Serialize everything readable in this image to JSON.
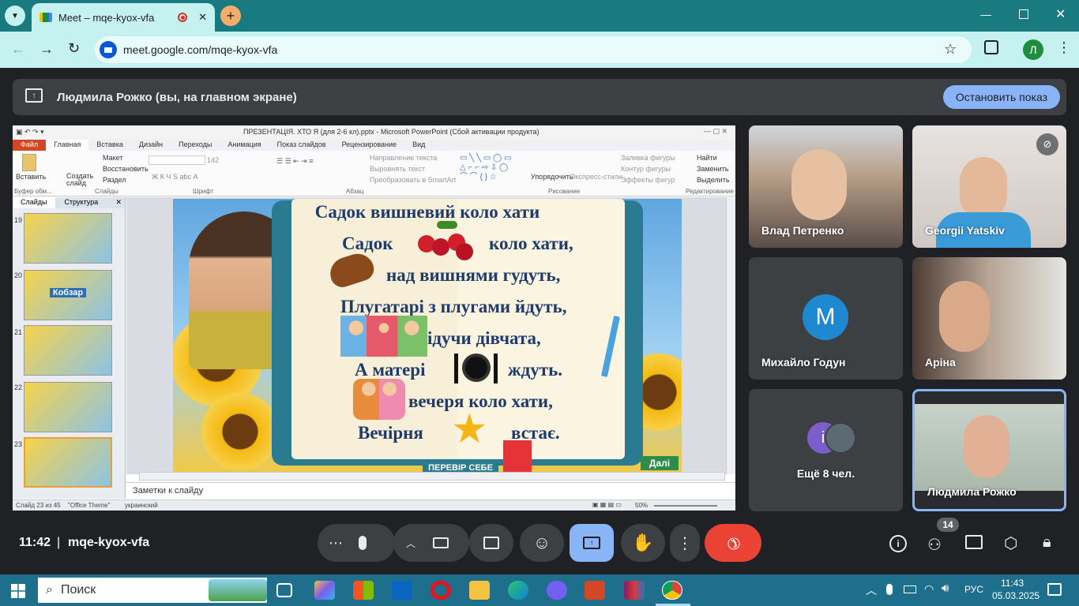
{
  "browser": {
    "tab_title": "Meet – mqe-kyox-vfa",
    "url": "meet.google.com/mqe-kyox-vfa",
    "profile_letter": "Л",
    "colors": {
      "tabbar": "#197a80",
      "toolbar": "#c6f1f1"
    }
  },
  "banner": {
    "presenter_text": "Людмила Рожко (вы, на главном экране)",
    "stop_label": "Остановить показ"
  },
  "ppt": {
    "title": "ПРЕЗЕНТАЦІЯ. ХТО Я (для 2-6 кл).pptx  -  Microsoft PowerPoint (Сбой активации продукта)",
    "tabs": [
      "Файл",
      "Главная",
      "Вставка",
      "Дизайн",
      "Переходы",
      "Анимация",
      "Показ слайдов",
      "Рецензирование",
      "Вид"
    ],
    "groups": [
      "Буфер обм...",
      "Слайды",
      "Шрифт",
      "Абзац",
      "Рисование",
      "Редактирование"
    ],
    "clipboard": {
      "paste": "Вставить"
    },
    "slides_group": {
      "new": "Создать слайд",
      "layout": "Макет",
      "reset": "Восстановить",
      "section": "Раздел"
    },
    "font_size": "142",
    "paragraph": {
      "direction": "Направление текста",
      "align": "Выровнять текст",
      "smartart": "Преобразовать в SmartArt"
    },
    "drawing": {
      "arrange": "Упорядочить",
      "styles": "Экспресс-стили",
      "fill": "Заливка фигуры",
      "outline": "Контур фигуры",
      "effects": "Эффекты фигур"
    },
    "editing": {
      "find": "Найти",
      "replace": "Заменить",
      "select": "Выделить"
    },
    "panel_tabs": [
      "Слайды",
      "Структура"
    ],
    "slide_numbers": [
      "19",
      "20",
      "21",
      "22",
      "23"
    ],
    "kobzar": "Кобзар",
    "notes_placeholder": "Заметки к слайду",
    "status": {
      "slide": "Слайд 23 из 45",
      "theme": "\"Office Theme\"",
      "lang": "украинский",
      "zoom": "50%"
    },
    "slide": {
      "heading": "Садок вишневий коло хати",
      "lines": [
        "Садок",
        "коло хати,",
        "над вишнями гудуть,",
        "Плугатарі з плугами йдуть,",
        "ідучи дівчата,",
        "А матері",
        "ждуть.",
        "вечеря коло хати,",
        "Вечірня",
        "встає."
      ],
      "check_label": "ПЕРЕВІР СЕБЕ",
      "next_label": "Далі"
    }
  },
  "participants": [
    {
      "name": "Влад Петренко"
    },
    {
      "name": "Georgii Yatskiv"
    },
    {
      "name": "Михайло Годун",
      "initial": "M"
    },
    {
      "name": "Аріна"
    },
    {
      "name": "Ещё 8 чел.",
      "initial": "i"
    },
    {
      "name": "Людмила Рожко"
    }
  ],
  "controls": {
    "time": "11:42",
    "meeting_code": "mqe-kyox-vfa",
    "people_count": "14",
    "colors": {
      "end_call": "#ea4335",
      "present_active": "#8ab4f8"
    }
  },
  "taskbar": {
    "search_label": "Поиск",
    "lang": "РУС",
    "time": "11:43",
    "date": "05.03.2025"
  }
}
